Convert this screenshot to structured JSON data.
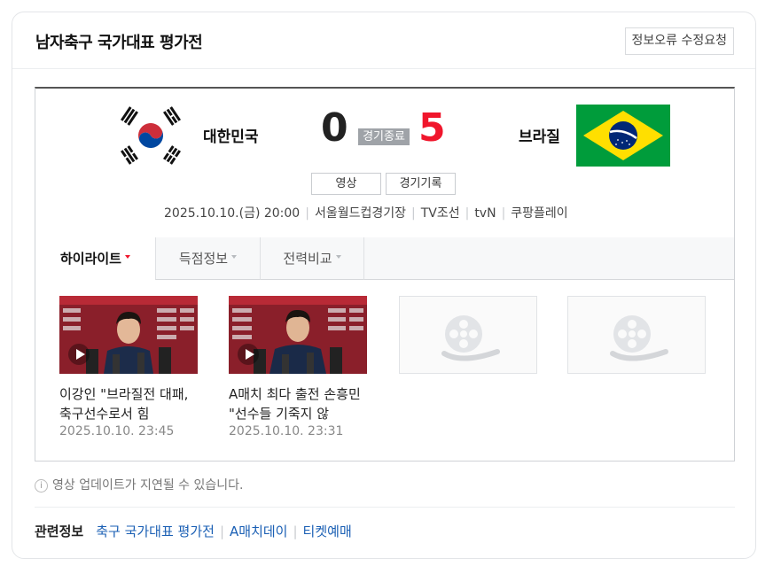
{
  "header": {
    "title": "남자축구 국가대표 평가전",
    "report_button": "정보오류 수정요청"
  },
  "match": {
    "home": {
      "name": "대한민국",
      "score": "0",
      "flag_icon": "south-korea-flag-icon"
    },
    "away": {
      "name": "브라질",
      "score": "5",
      "flag_icon": "brazil-flag-icon"
    },
    "status": "경기종료",
    "buttons": {
      "video": "영상",
      "record": "경기기록"
    },
    "info": {
      "datetime": "2025.10.10.(금) 20:00",
      "venue": "서울월드컵경기장",
      "broadcasters": [
        "TV조선",
        "tvN",
        "쿠팡플레이"
      ]
    },
    "colors": {
      "away_score": "#f0162c",
      "status_badge": "#9fa3a8"
    }
  },
  "tabs": [
    {
      "label": "하이라이트",
      "active": true
    },
    {
      "label": "득점정보",
      "active": false
    },
    {
      "label": "전력비교",
      "active": false
    }
  ],
  "videos": [
    {
      "title": "이강인 \"브라질전 대패, 축구선수로서 힘",
      "date": "2025.10.10. 23:45",
      "play_icon": "play-icon"
    },
    {
      "title": "A매치 최다 출전 손흥민 \"선수들 기죽지 않",
      "date": "2025.10.10. 23:31",
      "play_icon": "play-icon"
    }
  ],
  "placeholders": [
    {
      "icon": "film-reel-icon"
    },
    {
      "icon": "film-reel-icon"
    }
  ],
  "notice": "영상 업데이트가 지연될 수 있습니다.",
  "related": {
    "label": "관련정보",
    "links": [
      "축구 국가대표 평가전",
      "A매치데이",
      "티켓예매"
    ]
  }
}
